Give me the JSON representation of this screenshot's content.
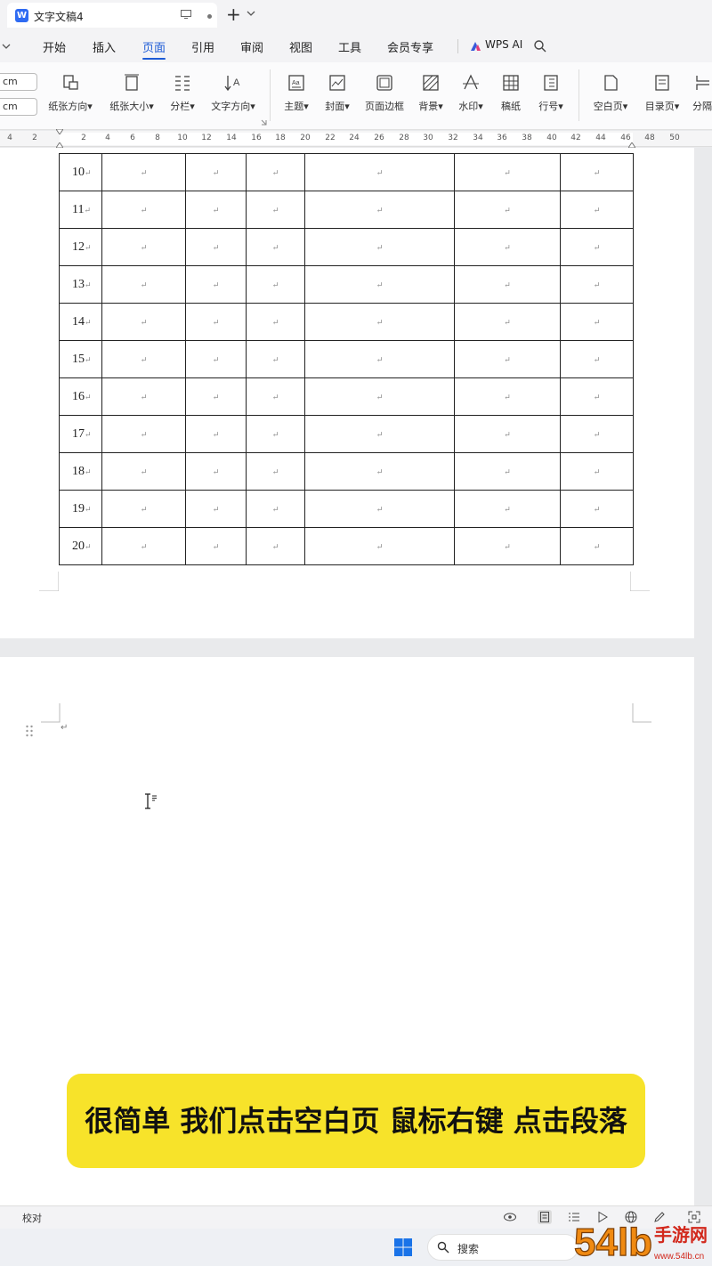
{
  "titlebar": {
    "doc_title": "文字文稿4",
    "new_tab": "+"
  },
  "menu": {
    "items": [
      "开始",
      "插入",
      "页面",
      "引用",
      "审阅",
      "视图",
      "工具",
      "会员专享"
    ],
    "active": "页面",
    "ai_label": "WPS AI"
  },
  "ribbon": {
    "unit": "cm",
    "items": [
      "纸张方向",
      "纸张大小",
      "分栏",
      "文字方向",
      "主题",
      "封面",
      "页面边框",
      "背景",
      "水印",
      "稿纸",
      "行号",
      "空白页",
      "目录页",
      "分隔"
    ],
    "dropdown_marker": "▾"
  },
  "ruler": {
    "ticks": [
      "4",
      "2",
      "2",
      "4",
      "6",
      "8",
      "10",
      "12",
      "14",
      "16",
      "18",
      "20",
      "22",
      "24",
      "26",
      "28",
      "30",
      "32",
      "34",
      "36",
      "38",
      "40",
      "42",
      "44",
      "46",
      "48",
      "50"
    ]
  },
  "table": {
    "rows": [
      "10",
      "11",
      "12",
      "13",
      "14",
      "15",
      "16",
      "17",
      "18",
      "19",
      "20"
    ],
    "cell_mark": "↵"
  },
  "page2": {
    "para_mark": "↵"
  },
  "caption": {
    "text": "很简单 我们点击空白页 鼠标右键 点击段落"
  },
  "statusbar": {
    "left_text": "校对"
  },
  "taskbar": {
    "search_label": "搜索"
  },
  "watermark": {
    "text_big": "54lb",
    "text_small": "手游网",
    "domain": "www.54lb.cn"
  },
  "colors": {
    "accent": "#1d5bd6",
    "caption_bg": "#f7e32a",
    "watermark_orange": "#f08a12"
  }
}
